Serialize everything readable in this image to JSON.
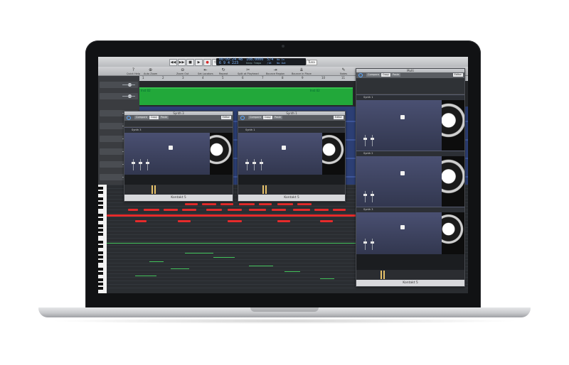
{
  "app": {
    "lcd": {
      "time": "00:09:24.48",
      "bars": "6 9 4 223",
      "tempo": "108.0000",
      "tempo_label": "Keep Tempo",
      "signature": "5/4",
      "signature_sub": "/16",
      "key_in": "No In",
      "key_out": "No Out"
    },
    "mode_button": "Tuna",
    "transport_icons": [
      "rewind-icon",
      "forward-icon",
      "stop-icon",
      "play-icon",
      "record-icon",
      "cycle-icon"
    ],
    "toolbar_items": [
      {
        "label": "Quick Help",
        "icon": "help-icon"
      },
      {
        "label": "Auto Zoom",
        "icon": "zoom-icon"
      },
      {
        "label": "Zoom Out",
        "icon": "zoom-out-icon"
      },
      {
        "label": "Set Locators",
        "icon": "locator-icon"
      },
      {
        "label": "Repeat",
        "icon": "repeat-icon"
      },
      {
        "label": "Split at Playhead",
        "icon": "split-icon"
      },
      {
        "label": "Bounce Region",
        "icon": "bounce-icon"
      },
      {
        "label": "Bounce in Place",
        "icon": "bounce-place-icon"
      },
      {
        "label": "Notes",
        "icon": "notes-icon"
      }
    ],
    "ruler_ticks": [
      "1",
      "2",
      "3",
      "4",
      "5",
      "6",
      "7",
      "8",
      "9",
      "10",
      "11",
      "12",
      "13",
      "14",
      "15",
      "16"
    ],
    "green_region": {
      "label_left": "Inst 02",
      "label_right": "Inst 02",
      "color": "#22a83a"
    },
    "note_color": "#e52b2b",
    "plugins": [
      {
        "window_title": "Synth 3",
        "tabs": [
          "Compare",
          "Copy",
          "Paste"
        ],
        "active_tab": "Copy",
        "edit_label": "Editor",
        "instruments": [
          "Synth 3"
        ],
        "footer": "Kontakt 5"
      },
      {
        "window_title": "Synth 1",
        "tabs": [
          "Compare",
          "Copy",
          "Paste"
        ],
        "active_tab": "Copy",
        "edit_label": "Editor",
        "instruments": [
          "Synth 1"
        ],
        "footer": "Kontakt 5"
      },
      {
        "window_title": "Multi",
        "tabs": [
          "Compare",
          "Copy",
          "Paste"
        ],
        "active_tab": "Copy",
        "edit_label": "Editor",
        "instruments": [
          "Synth 1",
          "Synth 2",
          "Synth 3"
        ],
        "footer": "Kontakt 5"
      }
    ]
  }
}
